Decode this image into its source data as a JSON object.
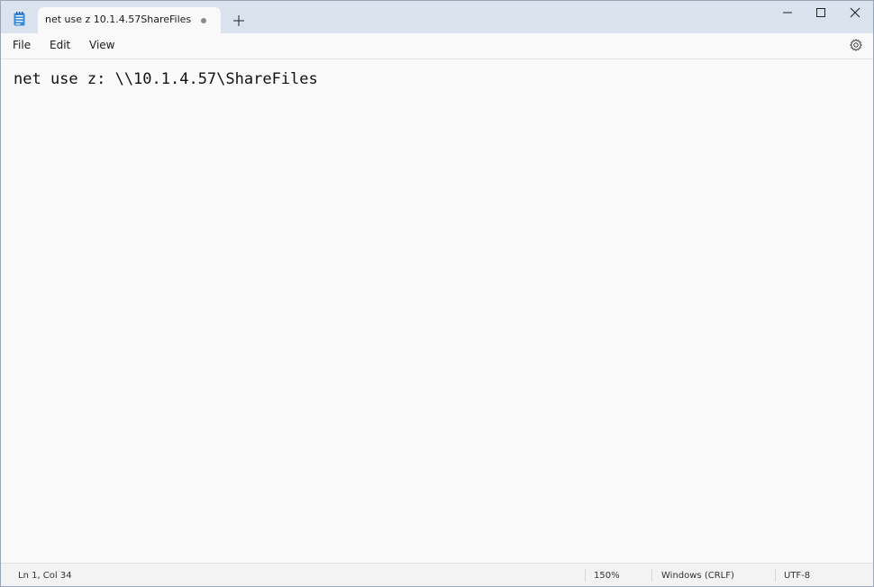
{
  "tab": {
    "title": "net use z 10.1.4.57ShareFiles",
    "unsaved_indicator": "dot-icon",
    "new_tab_icon": "plus-icon"
  },
  "window_controls": {
    "minimize_icon": "minimize-icon",
    "maximize_icon": "maximize-icon",
    "close_icon": "close-icon"
  },
  "menu": {
    "file": "File",
    "edit": "Edit",
    "view": "View",
    "settings_icon": "gear-icon"
  },
  "editor": {
    "content": "net use z: \\\\10.1.4.57\\ShareFiles"
  },
  "status": {
    "position": "Ln 1, Col 34",
    "zoom": "150%",
    "line_ending": "Windows (CRLF)",
    "encoding": "UTF-8"
  },
  "colors": {
    "titlebar": "#dbe3ef",
    "background": "#fafafa",
    "app_icon": "#2f7fd0"
  }
}
